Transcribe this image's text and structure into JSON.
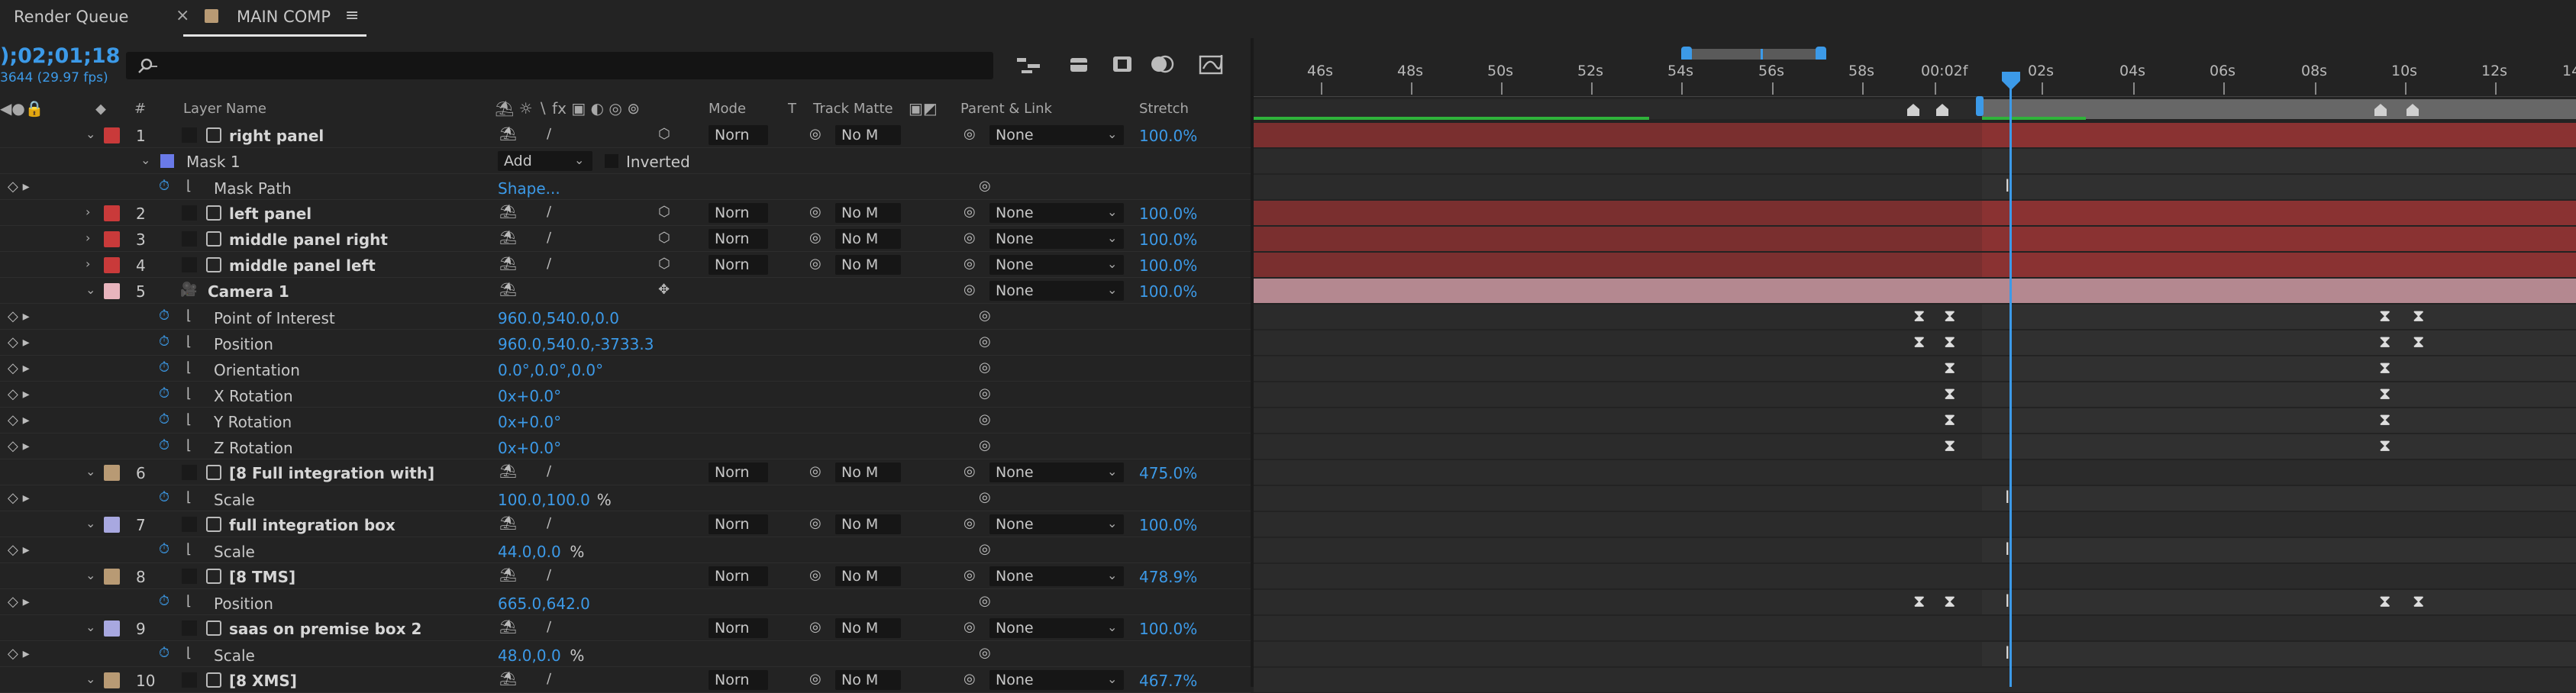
{
  "tabs": [
    {
      "label": "Render Queue",
      "close": "×"
    },
    {
      "label": "MAIN COMP",
      "menu": "≡"
    }
  ],
  "header": {
    "timecode": ");02;01;18",
    "fps": "3644 (29.97 fps)",
    "search_placeholder": ""
  },
  "columns": {
    "number": "#",
    "layer_name": "Layer Name",
    "mode": "Mode",
    "t": "T",
    "track_matte": "Track Matte",
    "parent": "Parent & Link",
    "stretch": "Stretch"
  },
  "ruler": {
    "labels": [
      "46s",
      "48s",
      "50s",
      "52s",
      "54s",
      "56s",
      "58s",
      "00:02f",
      "02s",
      "04s",
      "06s",
      "08s",
      "10s",
      "12s",
      "14"
    ]
  },
  "layers": [
    {
      "kind": "layer",
      "num": "1",
      "name": "right panel",
      "color": "#c93a3a",
      "expanded": true,
      "mode": "Norn",
      "matte": "No M",
      "parent": "None",
      "stretch": "100.0%"
    },
    {
      "kind": "mask",
      "name": "Mask 1",
      "color": "#6a7ae8",
      "mode": "Add",
      "inverted": "Inverted"
    },
    {
      "kind": "prop",
      "name": "Mask Path",
      "value": "Shape..."
    },
    {
      "kind": "layer",
      "num": "2",
      "name": "left panel",
      "color": "#c93a3a",
      "expanded": false,
      "mode": "Norn",
      "matte": "No M",
      "parent": "None",
      "stretch": "100.0%"
    },
    {
      "kind": "layer",
      "num": "3",
      "name": "middle panel right",
      "color": "#c93a3a",
      "expanded": false,
      "mode": "Norn",
      "matte": "No M",
      "parent": "None",
      "stretch": "100.0%"
    },
    {
      "kind": "layer",
      "num": "4",
      "name": "middle panel left",
      "color": "#c93a3a",
      "expanded": false,
      "mode": "Norn",
      "matte": "No M",
      "parent": "None",
      "stretch": "100.0%"
    },
    {
      "kind": "camera",
      "num": "5",
      "name": "Camera 1",
      "color": "#e8b4bd",
      "parent": "None",
      "stretch": "100.0%"
    },
    {
      "kind": "prop",
      "name": "Point of Interest",
      "value": "960.0,540.0,0.0"
    },
    {
      "kind": "prop",
      "name": "Position",
      "value": "960.0,540.0,-3733.3"
    },
    {
      "kind": "prop",
      "name": "Orientation",
      "value": "0.0°,0.0°,0.0°"
    },
    {
      "kind": "prop",
      "name": "X Rotation",
      "value": "0x+0.0°"
    },
    {
      "kind": "prop",
      "name": "Y Rotation",
      "value": "0x+0.0°"
    },
    {
      "kind": "prop",
      "name": "Z Rotation",
      "value": "0x+0.0°"
    },
    {
      "kind": "layer",
      "num": "6",
      "name": "[8 Full integration with]",
      "color": "#b89a74",
      "expanded": true,
      "mode": "Norn",
      "matte": "No M",
      "parent": "None",
      "stretch": "475.0%"
    },
    {
      "kind": "prop",
      "name": "Scale",
      "value": "100.0,100.0",
      "suffix": "%"
    },
    {
      "kind": "layer",
      "num": "7",
      "name": "full integration box",
      "color": "#a8a8e0",
      "expanded": true,
      "mode": "Norn",
      "matte": "No M",
      "parent": "None",
      "stretch": "100.0%"
    },
    {
      "kind": "prop",
      "name": "Scale",
      "value": "44.0,0.0",
      "suffix": "%"
    },
    {
      "kind": "layer",
      "num": "8",
      "name": "[8 TMS]",
      "color": "#b89a74",
      "expanded": true,
      "mode": "Norn",
      "matte": "No M",
      "parent": "None",
      "stretch": "478.9%"
    },
    {
      "kind": "prop",
      "name": "Position",
      "value": "665.0,642.0"
    },
    {
      "kind": "layer",
      "num": "9",
      "name": "saas on premise box 2",
      "color": "#a8a8e0",
      "expanded": true,
      "mode": "Norn",
      "matte": "No M",
      "parent": "None",
      "stretch": "100.0%"
    },
    {
      "kind": "prop",
      "name": "Scale",
      "value": "48.0,0.0",
      "suffix": "%"
    },
    {
      "kind": "layer",
      "num": "10",
      "name": "[8 XMS]",
      "color": "#b89a74",
      "expanded": true,
      "mode": "Norn",
      "matte": "No M",
      "parent": "None",
      "stretch": "467.7%"
    }
  ],
  "colors": {
    "accent": "#3c9ae8",
    "layer_red": "#7a2f2f",
    "camera_pink": "#b48890",
    "work_area": "#2fb33a"
  },
  "icons": [
    "search-icon",
    "shy-icon",
    "motion-blur-icon",
    "graph-editor-icon",
    "stopwatch-icon",
    "keyframe-icon"
  ]
}
